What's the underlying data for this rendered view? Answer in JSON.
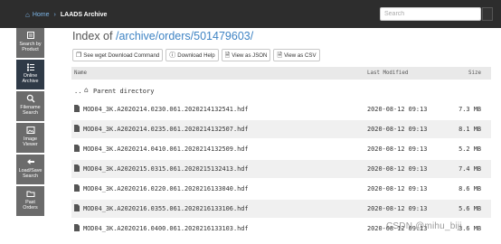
{
  "header": {
    "home_label": "Home",
    "section_label": "LAADS Archive",
    "search_placeholder": "Search"
  },
  "sidebar": {
    "items": [
      {
        "label_1": "Search by",
        "label_2": "Product",
        "icon": "search-by-product-icon",
        "active": false
      },
      {
        "label_1": "Online",
        "label_2": "Archive",
        "icon": "list-icon",
        "active": true
      },
      {
        "label_1": "Filename",
        "label_2": "Search",
        "icon": "magnifier-icon",
        "active": false
      },
      {
        "label_1": "Image",
        "label_2": "Viewer",
        "icon": "image-icon",
        "active": false
      },
      {
        "label_1": "Load/Save",
        "label_2": "Search",
        "icon": "reply-icon",
        "active": false
      },
      {
        "label_1": "Past",
        "label_2": "Orders",
        "icon": "folder-icon",
        "active": false
      }
    ]
  },
  "main": {
    "index_prefix": "Index of",
    "path_1": "archive",
    "path_2": "orders",
    "path_3": "501479603",
    "buttons": {
      "wget": "See wget Download Command",
      "download_help": "Download Help",
      "view_json": "View as JSON",
      "view_csv": "View as CSV"
    },
    "columns": {
      "name": "Name",
      "modified": "Last Modified",
      "size": "Size"
    },
    "parent_label": "Parent directory",
    "parent_dots": "..",
    "files": [
      {
        "name": "MOD04_3K.A2020214.0230.061.2020214132541.hdf",
        "modified": "2020-08-12 09:13",
        "size": "7.3 MB"
      },
      {
        "name": "MOD04_3K.A2020214.0235.061.2020214132507.hdf",
        "modified": "2020-08-12 09:13",
        "size": "8.1 MB"
      },
      {
        "name": "MOD04_3K.A2020214.0410.061.2020214132509.hdf",
        "modified": "2020-08-12 09:13",
        "size": "5.2 MB"
      },
      {
        "name": "MOD04_3K.A2020215.0315.061.2020215132413.hdf",
        "modified": "2020-08-12 09:13",
        "size": "7.4 MB"
      },
      {
        "name": "MOD04_3K.A2020216.0220.061.2020216133040.hdf",
        "modified": "2020-08-12 09:13",
        "size": "8.6 MB"
      },
      {
        "name": "MOD04_3K.A2020216.0355.061.2020216133106.hdf",
        "modified": "2020-08-12 09:13",
        "size": "5.6 MB"
      },
      {
        "name": "MOD04_3K.A2020216.0400.061.2020216133103.hdf",
        "modified": "2020-08-12 09:13",
        "size": "3.6 MB"
      }
    ]
  },
  "watermark": "CSDN @mihu_biji"
}
